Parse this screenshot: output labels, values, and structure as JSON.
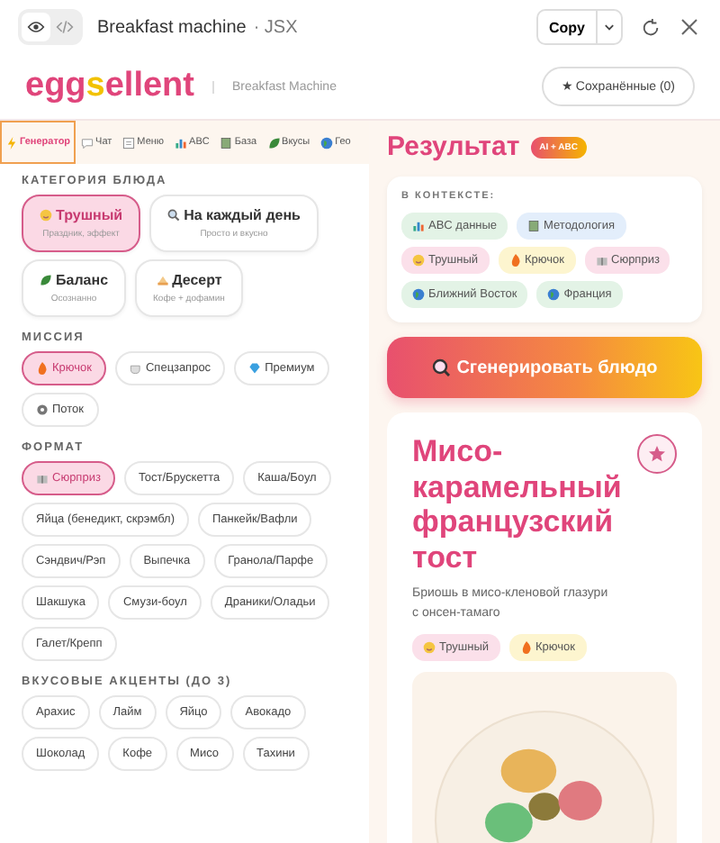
{
  "toolbar": {
    "title": "Breakfast machine",
    "subtitle": "· JSX",
    "view_modes": [
      {
        "selected": true
      },
      {
        "selected": false
      }
    ],
    "copy": "Copy"
  },
  "header": {
    "logo": [
      {
        "text": "egg",
        "color": "#e0457b"
      },
      {
        "text": "s",
        "color": "#f2c200"
      },
      {
        "text": "ellent",
        "color": "#e0457b"
      }
    ],
    "app_name": "Breakfast Machine",
    "saved_button": "★ Сохранённые (0)"
  },
  "tabs": [
    {
      "label": "Генератор",
      "selected": true
    },
    {
      "label": "Чат",
      "selected": false
    },
    {
      "label": "Меню",
      "selected": false
    },
    {
      "label": "ABC",
      "selected": false
    },
    {
      "label": "База",
      "selected": false
    },
    {
      "label": "Вкусы",
      "selected": false
    },
    {
      "label": "Гео",
      "selected": false
    }
  ],
  "sections": [
    {
      "title": "КАТЕГОРИЯ БЛЮДА",
      "kind": "cards",
      "items": [
        {
          "label": "Трушный",
          "sub": "Праздник, эффект",
          "selected": true
        },
        {
          "label": "На каждый день",
          "sub": "Просто и вкусно",
          "selected": false
        },
        {
          "label": "Баланс",
          "sub": "Осознанно",
          "selected": false
        },
        {
          "label": "Десерт",
          "sub": "Кофе + дофамин",
          "selected": false
        }
      ]
    },
    {
      "title": "МИССИЯ",
      "kind": "chips",
      "items": [
        {
          "label": "Крючок",
          "selected": true
        },
        {
          "label": "Спецзапрос",
          "selected": false
        },
        {
          "label": "Премиум",
          "selected": false
        },
        {
          "label": "Поток",
          "selected": false
        }
      ]
    },
    {
      "title": "ФОРМАТ",
      "kind": "chips",
      "items": [
        {
          "label": "Сюрприз",
          "selected": true
        },
        {
          "label": "Тост/Брускетта",
          "selected": false
        },
        {
          "label": "Каша/Боул",
          "selected": false
        },
        {
          "label": "Яйца (бенедикт, скрэмбл)",
          "selected": false
        },
        {
          "label": "Панкейк/Вафли",
          "selected": false
        },
        {
          "label": "Сэндвич/Рэп",
          "selected": false
        },
        {
          "label": "Выпечка",
          "selected": false
        },
        {
          "label": "Гранола/Парфе",
          "selected": false
        },
        {
          "label": "Шакшука",
          "selected": false
        },
        {
          "label": "Смузи-боул",
          "selected": false
        },
        {
          "label": "Драники/Оладьи",
          "selected": false
        },
        {
          "label": "Галет/Крепп",
          "selected": false
        }
      ]
    },
    {
      "title": "ВКУСОВЫЕ АКЦЕНТЫ (ДО 3)",
      "kind": "chips",
      "items": [
        {
          "label": "Арахис",
          "selected": false
        },
        {
          "label": "Лайм",
          "selected": false
        },
        {
          "label": "Яйцо",
          "selected": false
        },
        {
          "label": "Авокадо",
          "selected": false
        },
        {
          "label": "Шоколад",
          "selected": false
        },
        {
          "label": "Кофе",
          "selected": false
        },
        {
          "label": "Мисо",
          "selected": false
        },
        {
          "label": "Тахини",
          "selected": false
        }
      ]
    }
  ],
  "result": {
    "title": "Результат",
    "badge": "AI + ABC",
    "context_label": "В КОНТЕКСТЕ:",
    "context_tags": [
      {
        "label": "ABC данные",
        "color": "#e3f3e6"
      },
      {
        "label": "Методология",
        "color": "#e3eefb"
      },
      {
        "label": "Трушный",
        "color": "#fbe0ea"
      },
      {
        "label": "Крючок",
        "color": "#fdf5cf"
      },
      {
        "label": "Сюрприз",
        "color": "#fbe0ea"
      },
      {
        "label": "Ближний Восток",
        "color": "#e3f3e6"
      },
      {
        "label": "Франция",
        "color": "#e3f3e6"
      }
    ],
    "generate_button": "Сгенерировать блюдо",
    "dish": {
      "title": "Мисо-карамельный французский тост",
      "description": "Бриошь в мисо-кленовой глазури с онсен-тамаго",
      "saved": false,
      "tags": [
        {
          "label": "Трушный",
          "color": "#fbe0ea"
        },
        {
          "label": "Крючок",
          "color": "#fdf5cf"
        }
      ]
    }
  }
}
